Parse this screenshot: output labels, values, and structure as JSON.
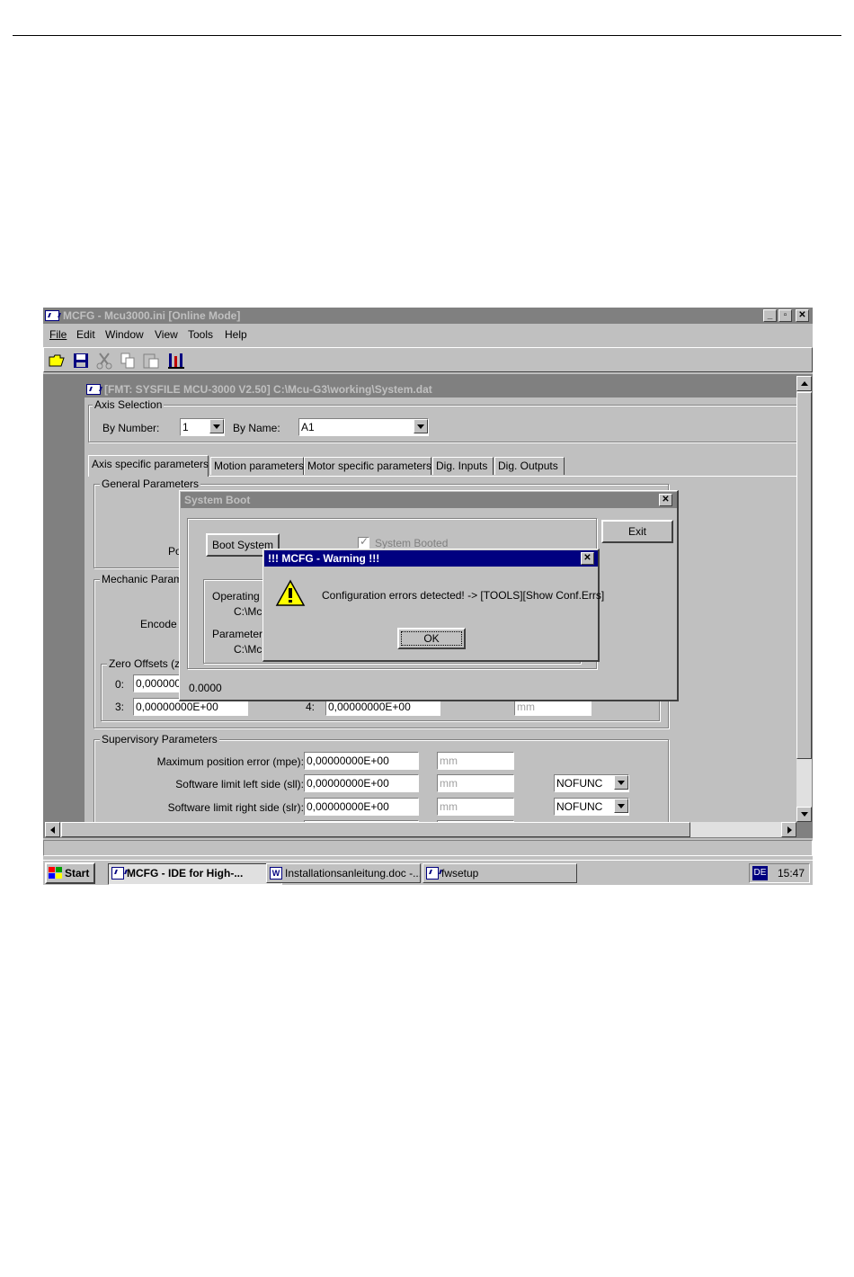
{
  "app": {
    "title": "MCFG - Mcu3000.ini [Online Mode]",
    "caption_buttons": [
      "_",
      "▫",
      "✕"
    ]
  },
  "menu": {
    "items": [
      {
        "label": "File"
      },
      {
        "label": "Edit"
      },
      {
        "label": "Window"
      },
      {
        "label": "View"
      },
      {
        "label": "Tools"
      },
      {
        "label": "Help"
      }
    ]
  },
  "toolbar": {
    "icons": [
      "open-folder-icon",
      "save-icon",
      "cut-icon",
      "copy-icon",
      "paste-icon",
      "connect-icon"
    ]
  },
  "child": {
    "title": "[FMT: SYSFILE MCU-3000 V2.50] C:\\Mcu-G3\\working\\System.dat",
    "axis_selection": {
      "group_label": "Axis Selection",
      "by_number_label": "By Number:",
      "by_number_value": "1",
      "by_name_label": "By Name:",
      "by_name_value": "A1"
    },
    "tabs": [
      {
        "label": "Axis specific parameters",
        "active": true
      },
      {
        "label": "Motion parameters"
      },
      {
        "label": "Motor specific parameters"
      },
      {
        "label": "Dig. Inputs"
      },
      {
        "label": "Dig. Outputs"
      }
    ],
    "general_group_label": "General Parameters",
    "general_partial_label": "Po",
    "mechanic_group_label": "Mechanic Param",
    "encoder_partial_label": "Encode",
    "zero_offsets": {
      "group_label": "Zero Offsets (zo",
      "row1": {
        "idx0": "0:",
        "val0": "0,000000"
      },
      "row2": {
        "idx3": "3:",
        "val3": "0,00000000E+00",
        "idx4": "4:",
        "val4": "0,00000000E+00",
        "unit": "mm"
      }
    },
    "supervisory": {
      "group_label": "Supervisory Parameters",
      "rows": [
        {
          "label": "Maximum position error (mpe):",
          "value": "0,00000000E+00",
          "unit": "mm",
          "func": ""
        },
        {
          "label": "Software limit left side (sll):",
          "value": "0,00000000E+00",
          "unit": "mm",
          "func": "NOFUNC"
        },
        {
          "label": "Software limit right side (slr):",
          "value": "0,00000000E+00",
          "unit": "mm",
          "func": "NOFUNC"
        }
      ]
    }
  },
  "system_boot": {
    "title": "System Boot",
    "boot_button": "Boot System",
    "booted_checkbox_label": "System Booted",
    "exit_button": "Exit",
    "operating_label": "Operating S",
    "operating_path": "C:\\Mc",
    "parameter_label": "Parameter S",
    "parameter_path": "C:\\Mc",
    "status_value": "0.0000"
  },
  "warning": {
    "title": "!!! MCFG - Warning !!!",
    "message": "Configuration errors detected! -> [TOOLS][Show Conf.Errs]",
    "ok_button": "OK"
  },
  "taskbar": {
    "start_label": "Start",
    "tasks": [
      {
        "label": "MCFG - IDE for High-..."
      },
      {
        "label": "Installationsanleitung.doc -..."
      },
      {
        "label": "fwsetup"
      }
    ],
    "language": "DE",
    "clock": "15:47"
  },
  "colors": {
    "active_title": "#000080",
    "inactive_title": "#808080",
    "face": "#c0c0c0",
    "mdi_background": "#808080"
  }
}
